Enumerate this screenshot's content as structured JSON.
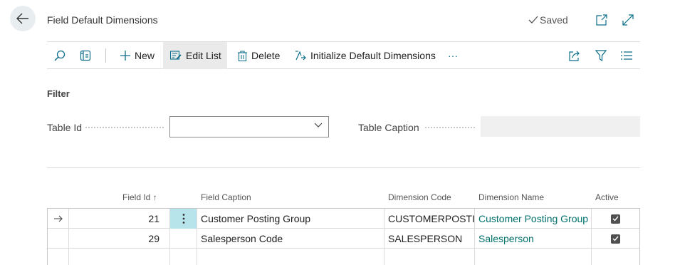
{
  "header": {
    "title": "Field Default Dimensions",
    "saved_label": "Saved"
  },
  "toolbar": {
    "new_label": "New",
    "edit_list_label": "Edit List",
    "delete_label": "Delete",
    "initialize_label": "Initialize Default Dimensions",
    "more_label": "···"
  },
  "filter": {
    "title": "Filter",
    "table_id_label": "Table Id",
    "table_id_value": "",
    "table_caption_label": "Table Caption",
    "table_caption_value": ""
  },
  "grid": {
    "columns": {
      "field_id": "Field Id",
      "field_id_sort": "↑",
      "field_caption": "Field Caption",
      "dimension_code": "Dimension Code",
      "dimension_name": "Dimension Name",
      "active": "Active"
    },
    "rows": [
      {
        "field_id": "21",
        "field_caption": "Customer Posting Group",
        "dimension_code": "CUSTOMERPOSTI...",
        "dimension_name": "Customer Posting Group",
        "active": true,
        "selected": true
      },
      {
        "field_id": "29",
        "field_caption": "Salesperson Code",
        "dimension_code": "SALESPERSON",
        "dimension_name": "Salesperson",
        "active": true,
        "selected": false
      }
    ]
  },
  "colors": {
    "accent_link": "#00706b",
    "row_menu_highlight": "#b7e3ea",
    "toolbar_active_bg": "#eaeaea"
  },
  "icons": [
    "back-arrow-icon",
    "checkmark-icon",
    "open-in-new-window-icon",
    "expand-icon",
    "search-icon",
    "view-icon",
    "plus-icon",
    "edit-list-icon",
    "trash-icon",
    "initialize-icon",
    "more-icon",
    "share-icon",
    "filter-icon",
    "list-icon",
    "row-pointer-arrow-icon",
    "row-menu-icon",
    "checkbox-checked-icon"
  ]
}
